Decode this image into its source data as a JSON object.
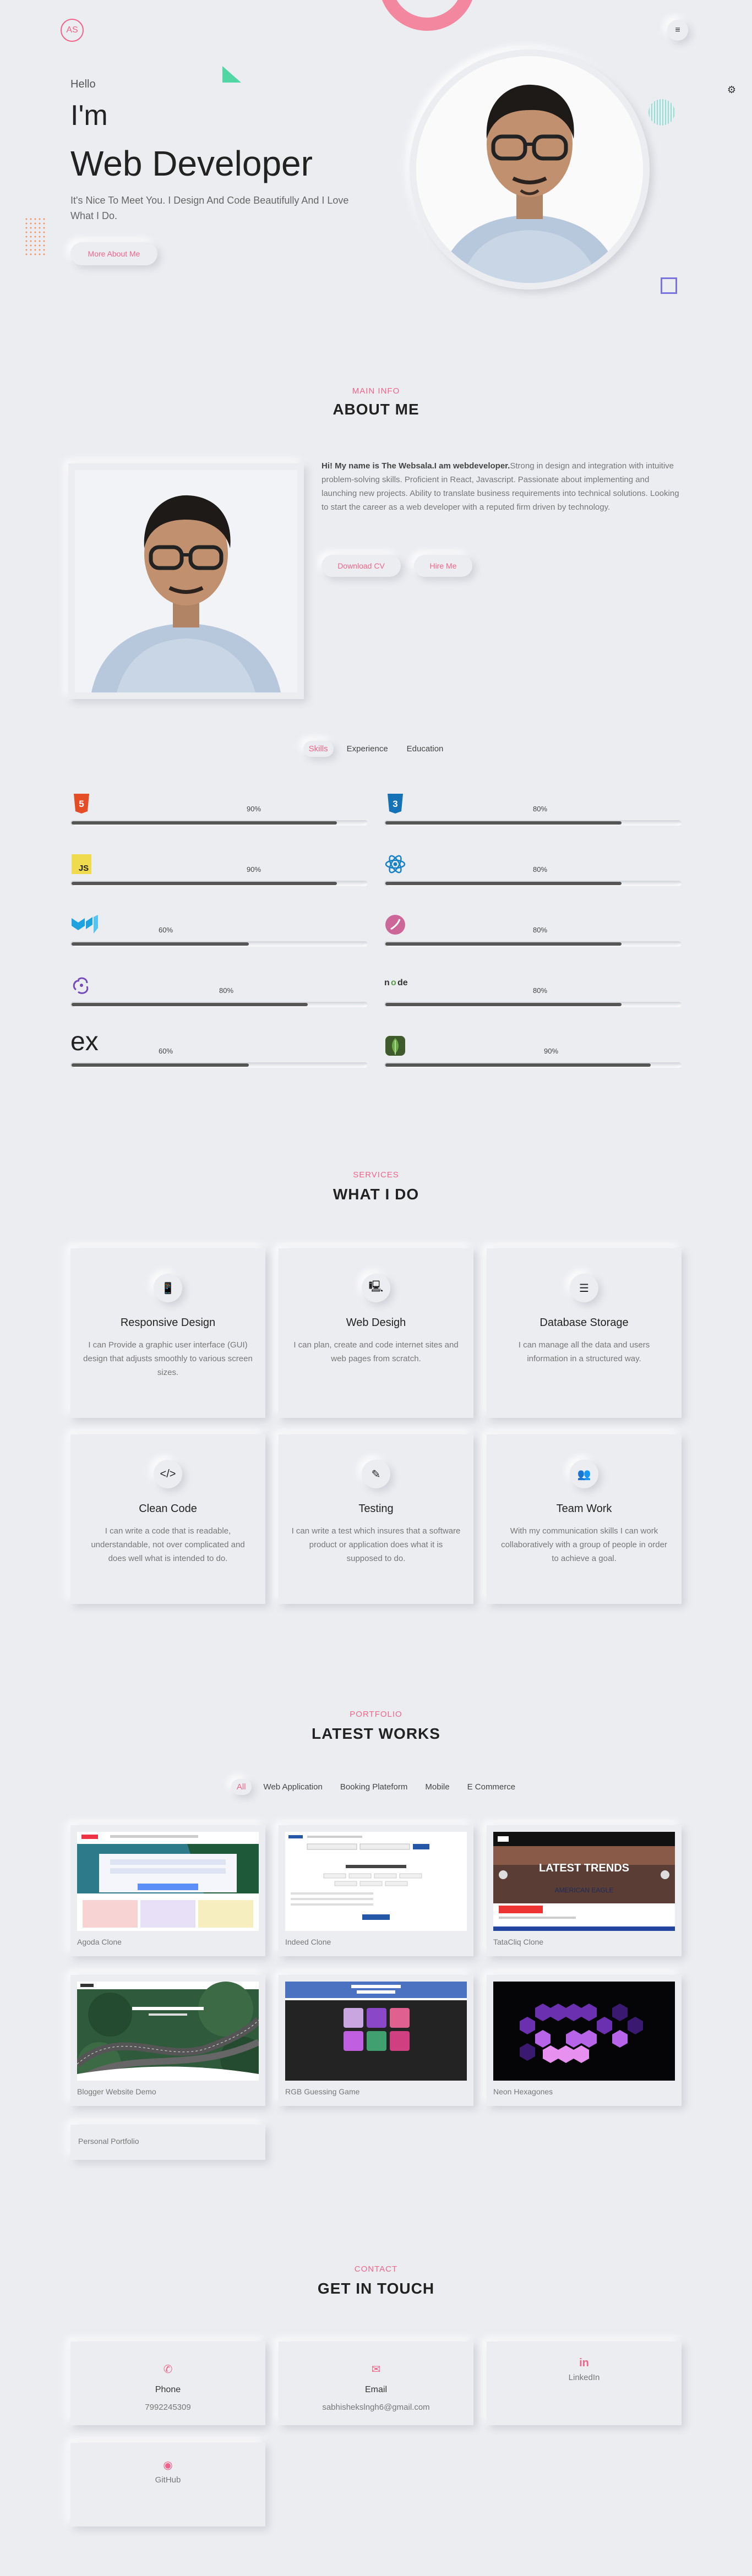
{
  "header": {
    "logo": "AS",
    "menu_icon": "≡",
    "settings_icon": "⚙"
  },
  "hero": {
    "hello": "Hello",
    "im": "I'm",
    "role": "Web Developer",
    "tagline": "It's Nice To Meet You. I Design And Code Beautifully And I Love What I Do.",
    "button": "More About Me"
  },
  "about": {
    "eyebrow": "MAIN INFO",
    "title": "ABOUT ME",
    "intro_bold": "Hi! My name is The Websala.I am webdeveloper.",
    "intro_rest": "Strong in design and integration with intuitive problem-solving skills. Proficient in React, Javascript. Passionate about implementing and launching new projects. Ability to translate business requirements into technical solutions. Looking to start the career as a web developer with a reputed firm driven by technology.",
    "download_cv": "Download CV",
    "hire_me": "Hire Me"
  },
  "skill_tabs": [
    "Skills",
    "Experience",
    "Education"
  ],
  "skills": [
    {
      "icon": "html5-icon",
      "percent": 90,
      "label": "90%"
    },
    {
      "icon": "css3-icon",
      "percent": 80,
      "label": "80%"
    },
    {
      "icon": "javascript-icon",
      "percent": 90,
      "label": "90%"
    },
    {
      "icon": "react-icon",
      "percent": 80,
      "label": "80%"
    },
    {
      "icon": "material-ui-icon",
      "percent": 60,
      "label": "60%"
    },
    {
      "icon": "sass-icon",
      "percent": 80,
      "label": "80%"
    },
    {
      "icon": "redux-icon",
      "percent": 80,
      "label": "80%"
    },
    {
      "icon": "nodejs-icon",
      "percent": 80,
      "label": "80%"
    },
    {
      "icon": "express-icon",
      "percent": 60,
      "label": "60%"
    },
    {
      "icon": "mongodb-icon",
      "percent": 90,
      "label": "90%"
    }
  ],
  "services": {
    "eyebrow": "SERVICES",
    "title": "WHAT I DO",
    "items": [
      {
        "icon": "📱",
        "title": "Responsive Design",
        "desc": "I can Provide a graphic user interface (GUI) design that adjusts smoothly to various screen sizes."
      },
      {
        "icon": "🖳",
        "title": "Web Desigh",
        "desc": "I can plan, create and code internet sites and web pages from scratch."
      },
      {
        "icon": "☰",
        "title": "Database Storage",
        "desc": "I can manage all the data and users information in a structured way."
      },
      {
        "icon": "</>",
        "title": "Clean Code",
        "desc": "I can write a code that is readable, understandable, not over complicated and does well what is intended to do."
      },
      {
        "icon": "✎",
        "title": "Testing",
        "desc": "I can write a test which insures that a software product or application does what it is supposed to do."
      },
      {
        "icon": "👥",
        "title": "Team Work",
        "desc": "With my communication skills I can work collaboratively with a group of people in order to achieve a goal."
      }
    ]
  },
  "portfolio": {
    "eyebrow": "PORTFOLIO",
    "title": "LATEST WORKS",
    "filters": [
      "All",
      "Web Application",
      "Booking Plateform",
      "Mobile",
      "E Commerce"
    ],
    "works": [
      {
        "caption": "Agoda Clone"
      },
      {
        "caption": "Indeed Clone"
      },
      {
        "caption": "TataCliq Clone",
        "shot_text": "LATEST TRENDS",
        "shot_sub": "AMERICAN EAGLE"
      },
      {
        "caption": "Blogger Website Demo"
      },
      {
        "caption": "RGB Guessing Game"
      },
      {
        "caption": "Neon Hexagones"
      }
    ],
    "extra": "Personal Portfolio"
  },
  "contact": {
    "eyebrow": "CONTACT",
    "title": "GET IN TOUCH",
    "items": [
      {
        "icon": "✆",
        "title": "Phone",
        "value": "7992245309"
      },
      {
        "icon": "✉",
        "title": "Email",
        "value": "sabhishekslngh6@gmail.com"
      },
      {
        "icon": "in",
        "title": "LinkedIn",
        "value": ""
      },
      {
        "icon": "◉",
        "title": "GitHub",
        "value": ""
      }
    ]
  },
  "colors": {
    "accent": "#f0648a",
    "background": "#ecedf1",
    "bar": "#555555"
  }
}
